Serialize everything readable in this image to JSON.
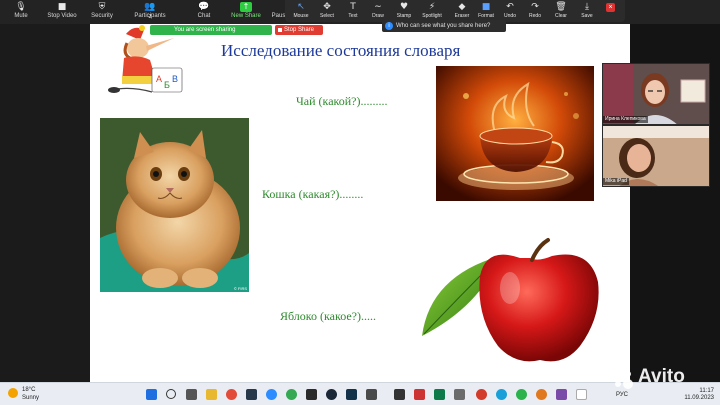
{
  "toolbar": {
    "items": [
      {
        "label": "Mute",
        "icon": "microphone-icon"
      },
      {
        "label": "Stop Video",
        "icon": "video-camera-icon"
      },
      {
        "label": "Security",
        "icon": "shield-icon"
      },
      {
        "label": "Participants",
        "icon": "participants-icon",
        "count": "2"
      },
      {
        "label": "Chat",
        "icon": "chat-icon"
      },
      {
        "label": "New Share",
        "icon": "share-screen-icon"
      },
      {
        "label": "Pause Share",
        "icon": "pause-icon"
      }
    ]
  },
  "annotate": {
    "items": [
      {
        "label": "Mouse",
        "icon": "cursor-icon"
      },
      {
        "label": "Select",
        "icon": "select-icon"
      },
      {
        "label": "Text",
        "icon": "text-icon"
      },
      {
        "label": "Draw",
        "icon": "draw-icon"
      },
      {
        "label": "Stamp",
        "icon": "stamp-icon"
      },
      {
        "label": "Spotlight",
        "icon": "spotlight-icon"
      },
      {
        "label": "Eraser",
        "icon": "eraser-icon"
      },
      {
        "label": "Format",
        "icon": "format-icon"
      },
      {
        "label": "Undo",
        "icon": "undo-icon"
      },
      {
        "label": "Redo",
        "icon": "redo-icon"
      },
      {
        "label": "Clear",
        "icon": "trash-icon"
      },
      {
        "label": "Save",
        "icon": "save-icon"
      }
    ]
  },
  "sharing": {
    "banner": "You are screen sharing",
    "stop_label": "Stop Share",
    "who_sees": "Who can see what you share here?"
  },
  "slide": {
    "title": "Исследование состояния словаря",
    "phrases": {
      "tea": "Чай (какой?).........",
      "cat": "Кошка (какая?)........",
      "apple": "Яблоко (какое?)....."
    },
    "cat_credit": "© FIRS"
  },
  "participants": [
    {
      "name": "Ирина Клепикова"
    },
    {
      "name": "Mika iPad"
    }
  ],
  "taskbar": {
    "weather_temp": "18°C",
    "weather_desc": "Sunny",
    "lang": "РУС",
    "time": "11:17",
    "date": "11.09.2023"
  },
  "watermark": {
    "text": "Avito"
  },
  "colors": {
    "title_blue": "#1e3a9a",
    "phrase_green": "#2e8a2e",
    "sharing_green": "#2fb34a",
    "stop_red": "#e03c31"
  }
}
